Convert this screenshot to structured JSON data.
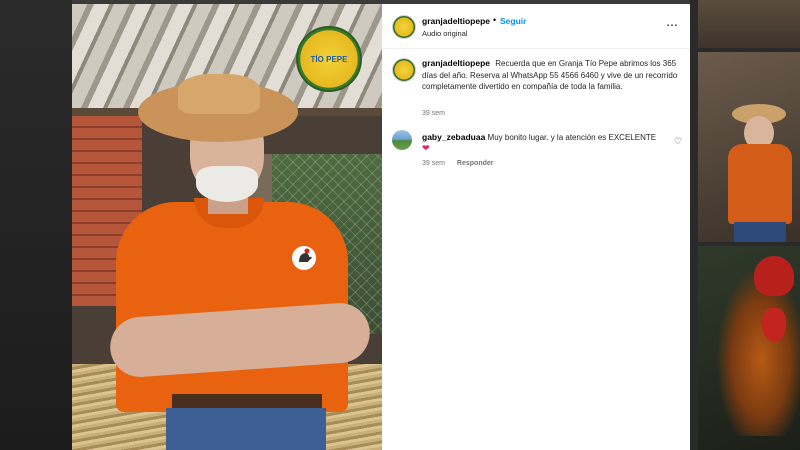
{
  "post": {
    "username": "granjadeltiopepe",
    "separator": "•",
    "follow_label": "Seguir",
    "audio_label": "Audio original",
    "more_icon": "⋯",
    "caption": "Recuerda que en Granja Tío Pepe abrimos los 365 días del año. Reserva al WhatsApp 55 4566 6460 y vive de un recorrido completamente divertido en compañía de toda la familia.",
    "caption_time": "39 sem"
  },
  "video": {
    "logo_text": "TÍO PEPE"
  },
  "comments": [
    {
      "username": "gaby_zebaduaa",
      "text": "Muy bonito lugar. y la atención es EXCELENTE",
      "emoji": "❤",
      "time": "39 sem",
      "reply_label": "Responder",
      "like_icon": "♡"
    }
  ],
  "colors": {
    "accent": "#0095f6",
    "heart": "#e0245e",
    "shirt": "#e8620f"
  }
}
